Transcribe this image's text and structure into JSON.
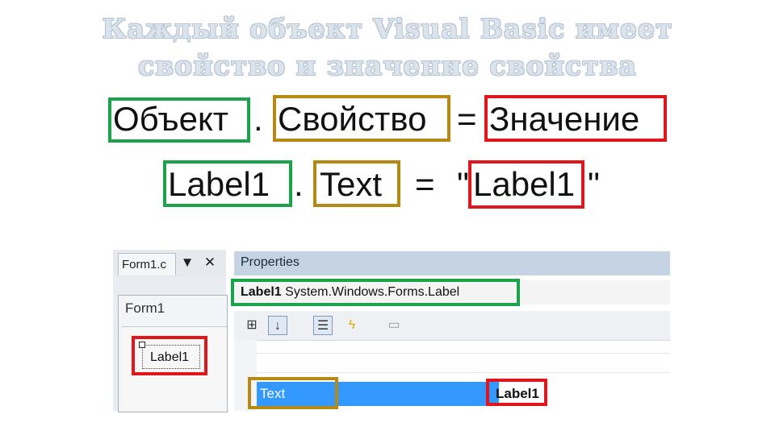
{
  "heading": {
    "line1": "Каждый объект Visual Basic имеет",
    "line2": "свойство и значение свойства"
  },
  "syntax": {
    "object": "Объект",
    "dot": ".",
    "property": "Свойство",
    "equals": "=",
    "value": "Значение"
  },
  "example": {
    "object": "Label1",
    "dot": ".",
    "property": "Text",
    "equals": "=",
    "quote_open": "\"",
    "value": "Label1",
    "quote_close": "\""
  },
  "ide": {
    "doc_tab": "Form1.c",
    "doc_pin": "▼",
    "doc_close": "✕",
    "form_title": "Form1",
    "label_text": "Label1",
    "properties_title": "Properties",
    "selected_object_name": "Label1",
    "selected_object_type": "System.Windows.Forms.Label",
    "property_name": "Text",
    "property_value": "Label1"
  },
  "colors": {
    "object_box": "#1aa34a",
    "property_box": "#b48a14",
    "value_box": "#e1151c",
    "selection": "#3399ff"
  },
  "icons": [
    "categorized-icon",
    "alphabetical-icon",
    "properties-icon",
    "events-icon",
    "property-pages-icon"
  ]
}
